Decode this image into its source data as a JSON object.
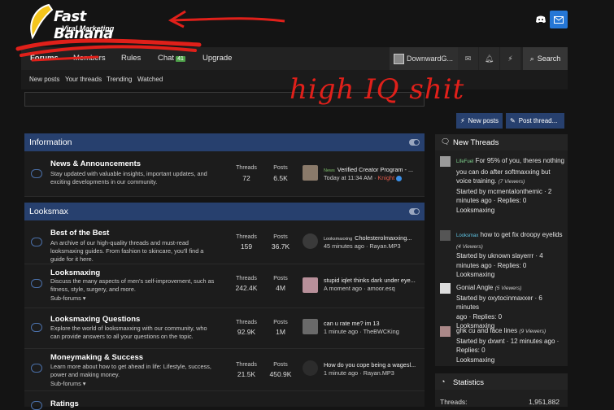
{
  "brand": {
    "name": "Fast Banana",
    "tagline": "Viral Marketing",
    "accent": "#27406e"
  },
  "header_icons": [
    "discord-icon",
    "mail-icon"
  ],
  "nav": {
    "forums": "Forums",
    "members": "Members",
    "rules": "Rules",
    "chat": "Chat",
    "chat_count": "41",
    "upgrade": "Upgrade",
    "user": "DownwardG...",
    "search": "Search"
  },
  "subnav": [
    "New posts",
    "Your threads",
    "Trending",
    "Watched"
  ],
  "actions": {
    "new_posts": "New posts",
    "post_thread": "Post thread..."
  },
  "annotation": "high IQ shit",
  "categories": [
    {
      "name": "Information"
    },
    {
      "name": "Looksmax"
    }
  ],
  "forums": [
    {
      "title": "News & Announcements",
      "desc": "Stay updated with valuable insights, important updates, and exciting developments in our community.",
      "sub": "",
      "threads_h": "Threads",
      "threads": "72",
      "posts_h": "Posts",
      "posts": "6.5K",
      "prefix": "News",
      "last": "Verified Creator Program - ...",
      "time": "Today at 11:34 AM",
      "sep": "·",
      "user": "Knight"
    },
    {
      "title": "Best of the Best",
      "desc": "An archive of our high-quality threads and must-read looksmaxing guides. From fashion to skincare, you'll find a guide for it here.",
      "sub": "",
      "threads_h": "Threads",
      "threads": "159",
      "posts_h": "Posts",
      "posts": "36.7K",
      "prefix": "Looksmaxxing",
      "last": "Cholesterolmaxxing...",
      "time": "45 minutes ago",
      "sep": "·",
      "user": "Rayan.MP3"
    },
    {
      "title": "Looksmaxing",
      "desc": "Discuss the many aspects of men's self-improvement, such as fitness, style, surgery, and more.",
      "sub": "Sub-forums ▾",
      "threads_h": "Threads",
      "threads": "242.4K",
      "posts_h": "Posts",
      "posts": "4M",
      "prefix": "",
      "last": "stupid iqlet thinks dark under eye...",
      "time": "A moment ago",
      "sep": "·",
      "user": "amoor.esq"
    },
    {
      "title": "Looksmaxing Questions",
      "desc": "Explore the world of looksmaxxing with our community, who can provide answers to all your questions on the topic.",
      "sub": "",
      "threads_h": "Threads",
      "threads": "92.9K",
      "posts_h": "Posts",
      "posts": "1M",
      "prefix": "",
      "last": "can u rate me? im 13",
      "time": "1 minute ago",
      "sep": "·",
      "user": "TheBWCKing"
    },
    {
      "title": "Moneymaking & Success",
      "desc": "Learn more about how to get ahead in life: Lifestyle, success, power and making money.",
      "sub": "Sub-forums ▾",
      "threads_h": "Threads",
      "threads": "21.5K",
      "posts_h": "Posts",
      "posts": "450.9K",
      "prefix": "",
      "last": "How do you cope being a wagesl...",
      "time": "1 minute ago",
      "sep": "·",
      "user": "Rayan.MP3"
    },
    {
      "title": "Ratings",
      "desc": "",
      "sub": "",
      "threads_h": "",
      "threads": "",
      "posts_h": "",
      "posts": "",
      "prefix": "",
      "last": "",
      "time": "",
      "sep": "",
      "user": ""
    }
  ],
  "sidebar": {
    "title": "New Threads",
    "threads": [
      {
        "prefix": "LifeFuel",
        "title": "For 95% of you, theres nothing you can do after softmaxxing but voice training.",
        "viewers": "(7 Viewers)",
        "meta1": "Started by mcmentalonthemic · 2",
        "meta2": "minutes ago · Replies: 0",
        "forum": "Looksmaxing"
      },
      {
        "prefix": "Looksmax",
        "title": "how to get fix droopy eyelids",
        "viewers": "(4 Viewers)",
        "meta1": "Started by uknown slayerrr · 4",
        "meta2": "minutes ago · Replies: 0",
        "forum": "Looksmaxing"
      },
      {
        "prefix": "",
        "title": "Gonial Angle",
        "viewers": "(5 Viewers)",
        "meta1": "Started by oxytocinmaxxer · 6 minutes",
        "meta2": "ago · Replies: 0",
        "forum": "Looksmaxing"
      },
      {
        "prefix": "",
        "title": "ghk cu and face lines",
        "viewers": "(9 Viewers)",
        "meta1": "Started by dxwnt · 12 minutes ago ·",
        "meta2": "Replies: 0",
        "forum": "Looksmaxing"
      }
    ],
    "stats_title": "Statistics",
    "stats_label": "Threads:",
    "stats_value": "1,951,882"
  }
}
